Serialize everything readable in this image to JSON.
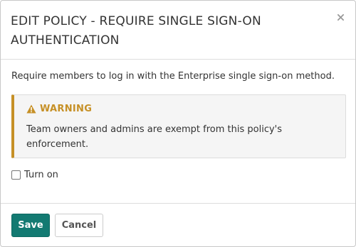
{
  "modal": {
    "title": "EDIT POLICY - REQUIRE SINGLE SIGN-ON AUTHENTICATION",
    "close_icon": "close-icon",
    "description": "Require members to log in with the Enterprise single sign-on method.",
    "warning": {
      "icon": "warning-triangle-icon",
      "title": "WARNING",
      "text": "Team owners and admins are exempt from this policy's enforcement."
    },
    "turn_on": {
      "label": "Turn on",
      "checked": false
    },
    "footer": {
      "save_label": "Save",
      "cancel_label": "Cancel"
    }
  },
  "colors": {
    "accent": "#137a72",
    "warning": "#c69026"
  }
}
